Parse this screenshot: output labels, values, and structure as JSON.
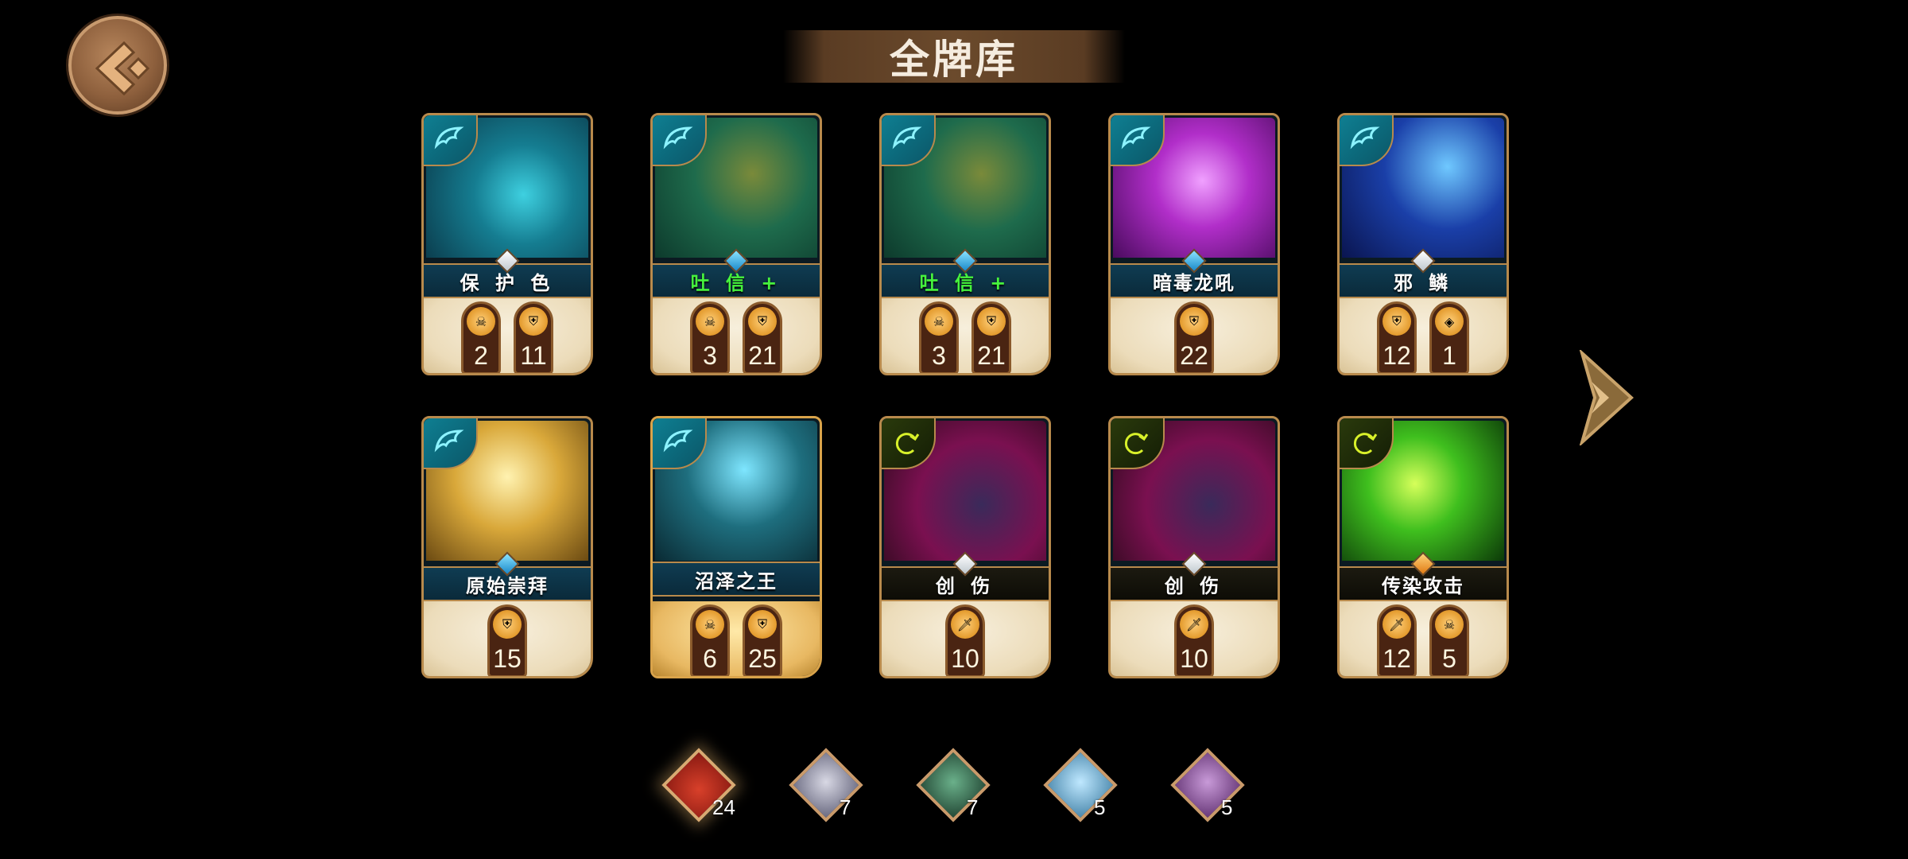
{
  "header": {
    "title": "全牌库",
    "back_icon": "back-arrow-icon"
  },
  "cards": [
    {
      "name": "保 护 色",
      "name_color": "white",
      "type_icon": "dragon-icon",
      "gem": "white",
      "stats": [
        {
          "icon": "skull-icon",
          "value": "2"
        },
        {
          "icon": "shield-icon",
          "value": "11"
        }
      ]
    },
    {
      "name": "吐 信 +",
      "name_color": "green",
      "type_icon": "dragon-icon",
      "gem": "blue",
      "stats": [
        {
          "icon": "skull-icon",
          "value": "3"
        },
        {
          "icon": "shield-icon",
          "value": "21"
        }
      ]
    },
    {
      "name": "吐 信 +",
      "name_color": "green",
      "type_icon": "dragon-icon",
      "gem": "blue",
      "stats": [
        {
          "icon": "skull-icon",
          "value": "3"
        },
        {
          "icon": "shield-icon",
          "value": "21"
        }
      ]
    },
    {
      "name": "暗毒龙吼",
      "name_color": "white",
      "type_icon": "dragon-icon",
      "gem": "blue",
      "stats": [
        {
          "icon": "shield-icon",
          "value": "22"
        }
      ]
    },
    {
      "name": "邪 鳞",
      "name_color": "white",
      "type_icon": "dragon-icon",
      "gem": "white",
      "stats": [
        {
          "icon": "shield-icon",
          "value": "12"
        },
        {
          "icon": "gem-coin-icon",
          "value": "1"
        }
      ]
    },
    {
      "name": "原始崇拜",
      "name_color": "white",
      "type_icon": "dragon-icon",
      "gem": "blue",
      "stats": [
        {
          "icon": "shield-icon",
          "value": "15"
        }
      ]
    },
    {
      "name": "沼泽之王",
      "name_color": "white",
      "type_icon": "dragon-icon",
      "gem": "none",
      "stats": [
        {
          "icon": "skull-icon",
          "value": "6"
        },
        {
          "icon": "shield-icon",
          "value": "25"
        }
      ]
    },
    {
      "name": "创 伤",
      "name_color": "white",
      "type_icon": "swirl-icon",
      "gem": "white",
      "stats": [
        {
          "icon": "sword-icon",
          "value": "10"
        }
      ]
    },
    {
      "name": "创 伤",
      "name_color": "white",
      "type_icon": "swirl-icon",
      "gem": "white",
      "stats": [
        {
          "icon": "sword-icon",
          "value": "10"
        }
      ]
    },
    {
      "name": "传染攻击",
      "name_color": "white",
      "type_icon": "swirl-icon",
      "gem": "orange",
      "stats": [
        {
          "icon": "sword-icon",
          "value": "12"
        },
        {
          "icon": "skull-icon",
          "value": "5"
        }
      ]
    }
  ],
  "pager": {
    "next_icon": "next-arrow-icon"
  },
  "hero_tabs": [
    {
      "icon": "deck-emblem-icon",
      "count": "24",
      "active": true
    },
    {
      "icon": "hero-portrait-icon",
      "count": "7"
    },
    {
      "icon": "hero-portrait-icon",
      "count": "7"
    },
    {
      "icon": "hero-portrait-icon",
      "count": "5"
    },
    {
      "icon": "hero-portrait-icon",
      "count": "5"
    }
  ],
  "colors": {
    "card_border": "#b88a4c",
    "name_green": "#46f23d",
    "accent_gold": "#c99a6a"
  }
}
